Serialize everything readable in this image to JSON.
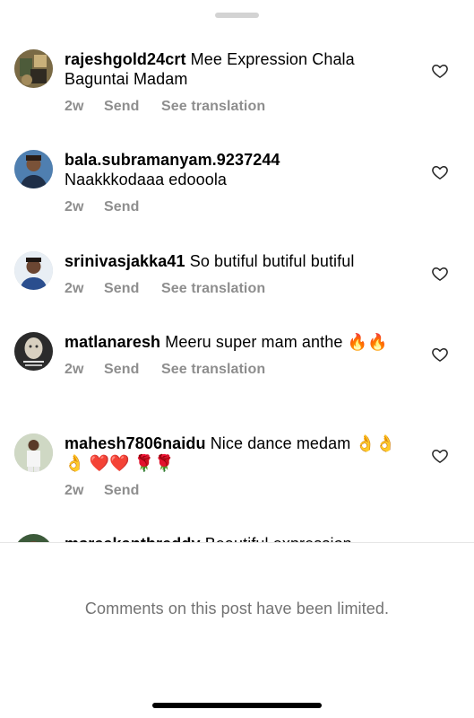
{
  "comments": [
    {
      "username": "rajeshgold24crt",
      "text": "Mee Expression Chala Baguntai Madam",
      "time": "2w",
      "send": "Send",
      "translate": "See translation",
      "avatar_icon": "profile-photo"
    },
    {
      "username": "bala.subramanyam.9237244",
      "text": "Naakkkodaaa edooola",
      "time": "2w",
      "send": "Send",
      "translate": "",
      "avatar_icon": "profile-photo"
    },
    {
      "username": "srinivasjakka41",
      "text": "So butiful butiful butiful",
      "time": "2w",
      "send": "Send",
      "translate": "See translation",
      "avatar_icon": "profile-photo"
    },
    {
      "username": "matlanaresh",
      "text": "Meeru super mam anthe 🔥🔥",
      "time": "2w",
      "send": "Send",
      "translate": "See translation",
      "avatar_icon": "profile-photo"
    },
    {
      "username": "mahesh7806naidu",
      "text": "Nice dance medam 👌👌👌 ❤️❤️ 🌹🌹",
      "time": "2w",
      "send": "Send",
      "translate": "",
      "avatar_icon": "profile-photo"
    },
    {
      "username": "msreekanthreddy",
      "text": "Beautiful expression",
      "time": "",
      "send": "",
      "translate": "",
      "avatar_icon": "profile-photo"
    }
  ],
  "footer": {
    "limited_notice": "Comments on this post have been limited."
  },
  "icons": {
    "like": "heart-outline-icon",
    "sheet_handle": "grabber-handle"
  },
  "colors": {
    "meta_text": "#8e8e8e",
    "notice_text": "#737373"
  }
}
